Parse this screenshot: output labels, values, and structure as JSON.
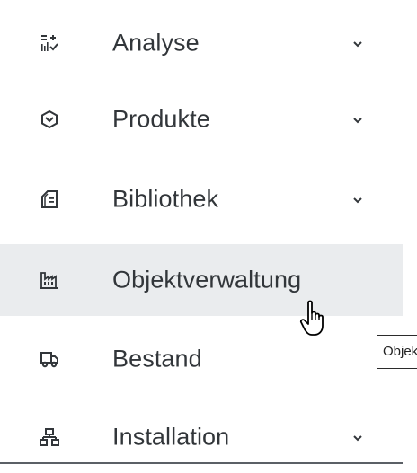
{
  "nav": {
    "items": [
      {
        "label": "Analyse",
        "icon": "analytics-icon",
        "expandable": true
      },
      {
        "label": "Produkte",
        "icon": "product-icon",
        "expandable": true
      },
      {
        "label": "Bibliothek",
        "icon": "library-icon",
        "expandable": true
      },
      {
        "label": "Objektverwaltung",
        "icon": "factory-icon",
        "expandable": false,
        "hovered": true
      },
      {
        "label": "Bestand",
        "icon": "truck-icon",
        "expandable": false
      },
      {
        "label": "Installation",
        "icon": "hierarchy-icon",
        "expandable": true
      }
    ]
  },
  "tooltip": {
    "text": "Objektverwaltung"
  },
  "colors": {
    "text": "#32363a",
    "hover_background": "#eaecee",
    "icon": "#32363a"
  }
}
